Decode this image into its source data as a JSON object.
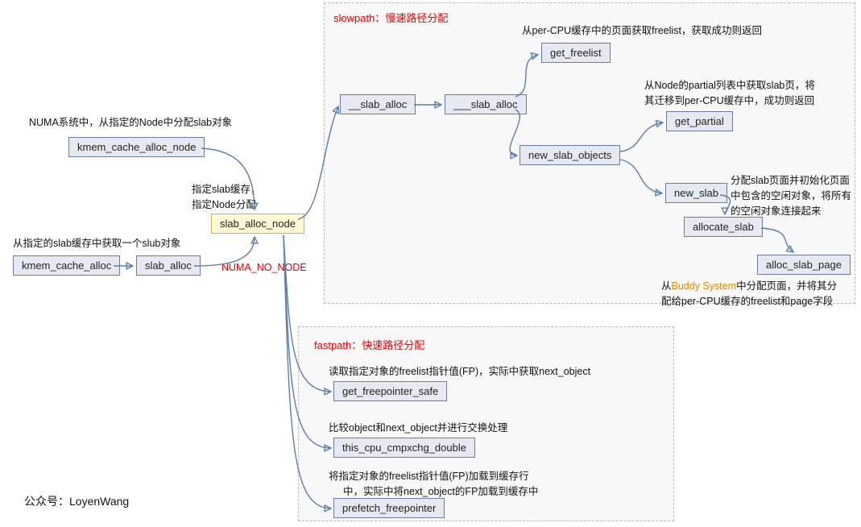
{
  "panels": {
    "slow": {
      "title_prefix": "slowpath：",
      "title_main": "慢速路径分配"
    },
    "fast": {
      "title_prefix": "fastpath：",
      "title_main": "快速路径分配"
    }
  },
  "nodes": {
    "kmem_cache_alloc_node": "kmem_cache_alloc_node",
    "kmem_cache_alloc": "kmem_cache_alloc",
    "slab_alloc": "slab_alloc",
    "slab_alloc_node": "slab_alloc_node",
    "__slab_alloc": "__slab_alloc",
    "___slab_alloc": "___slab_alloc",
    "get_freelist": "get_freelist",
    "new_slab_objects": "new_slab_objects",
    "get_partial": "get_partial",
    "new_slab": "new_slab",
    "allocate_slab": "allocate_slab",
    "alloc_slab_page": "alloc_slab_page",
    "get_freepointer_safe": "get_freepointer_safe",
    "this_cpu_cmpxchg_double": "this_cpu_cmpxchg_double",
    "prefetch_freepointer": "prefetch_freepointer"
  },
  "labels": {
    "numa_sys": "NUMA系统中，从指定的Node中分配slab对象",
    "from_slab_cache": "从指定的slab缓存中获取一个slub对象",
    "specify_cache_line1": "指定slab缓存，",
    "specify_cache_line2": "指定Node分配",
    "numa_no_node": "NUMA_NO_NODE",
    "get_freelist_desc": "从per-CPU缓存中的页面获取freelist，获取成功则返回",
    "get_partial_l1": "从Node的partial列表中获取slab页，将",
    "get_partial_l2": "其迁移到per-CPU缓存中，成功则返回",
    "new_slab_l1": "分配slab页面并初始化页面",
    "new_slab_l2": "中包含的空闲对象，将所有",
    "new_slab_l3": "的空闲对象连接起来",
    "alloc_page_l1_pre": "从",
    "alloc_page_l1_buddy": "Buddy System",
    "alloc_page_l1_post": "中分配页面，并将其分",
    "alloc_page_l2": "配给per-CPU缓存的freelist和page字段",
    "fast_desc1": "读取指定对象的freelist指针值(FP)，实际中获取next_object",
    "fast_desc2": "比较object和next_object并进行交换处理",
    "fast_desc3_l1": "将指定对象的freelist指针值(FP)加载到缓存行",
    "fast_desc3_l2": "中，实际中将next_object的FP加载到缓存中",
    "footer": "公众号：LoyenWang"
  }
}
